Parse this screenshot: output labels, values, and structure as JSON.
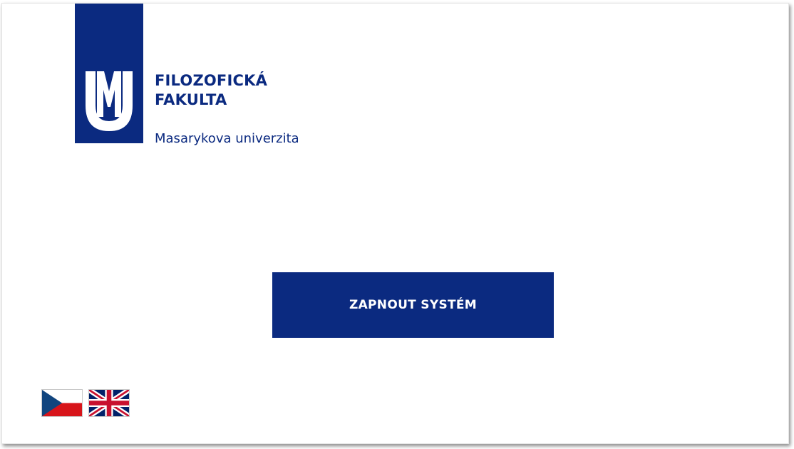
{
  "header": {
    "faculty_line1": "FILOZOFICKÁ",
    "faculty_line2": "FAKULTA",
    "university": "Masarykova univerzita",
    "logo_icon": "muni-logo-icon",
    "logo_letters": "MU"
  },
  "main": {
    "start_button_label": "ZAPNOUT SYSTÉM"
  },
  "languages": [
    {
      "code": "cs",
      "icon": "czech-flag-icon"
    },
    {
      "code": "en",
      "icon": "uk-flag-icon"
    }
  ],
  "colors": {
    "brand": "#0b2a80",
    "background": "#ffffff",
    "button_text": "#ffffff"
  }
}
